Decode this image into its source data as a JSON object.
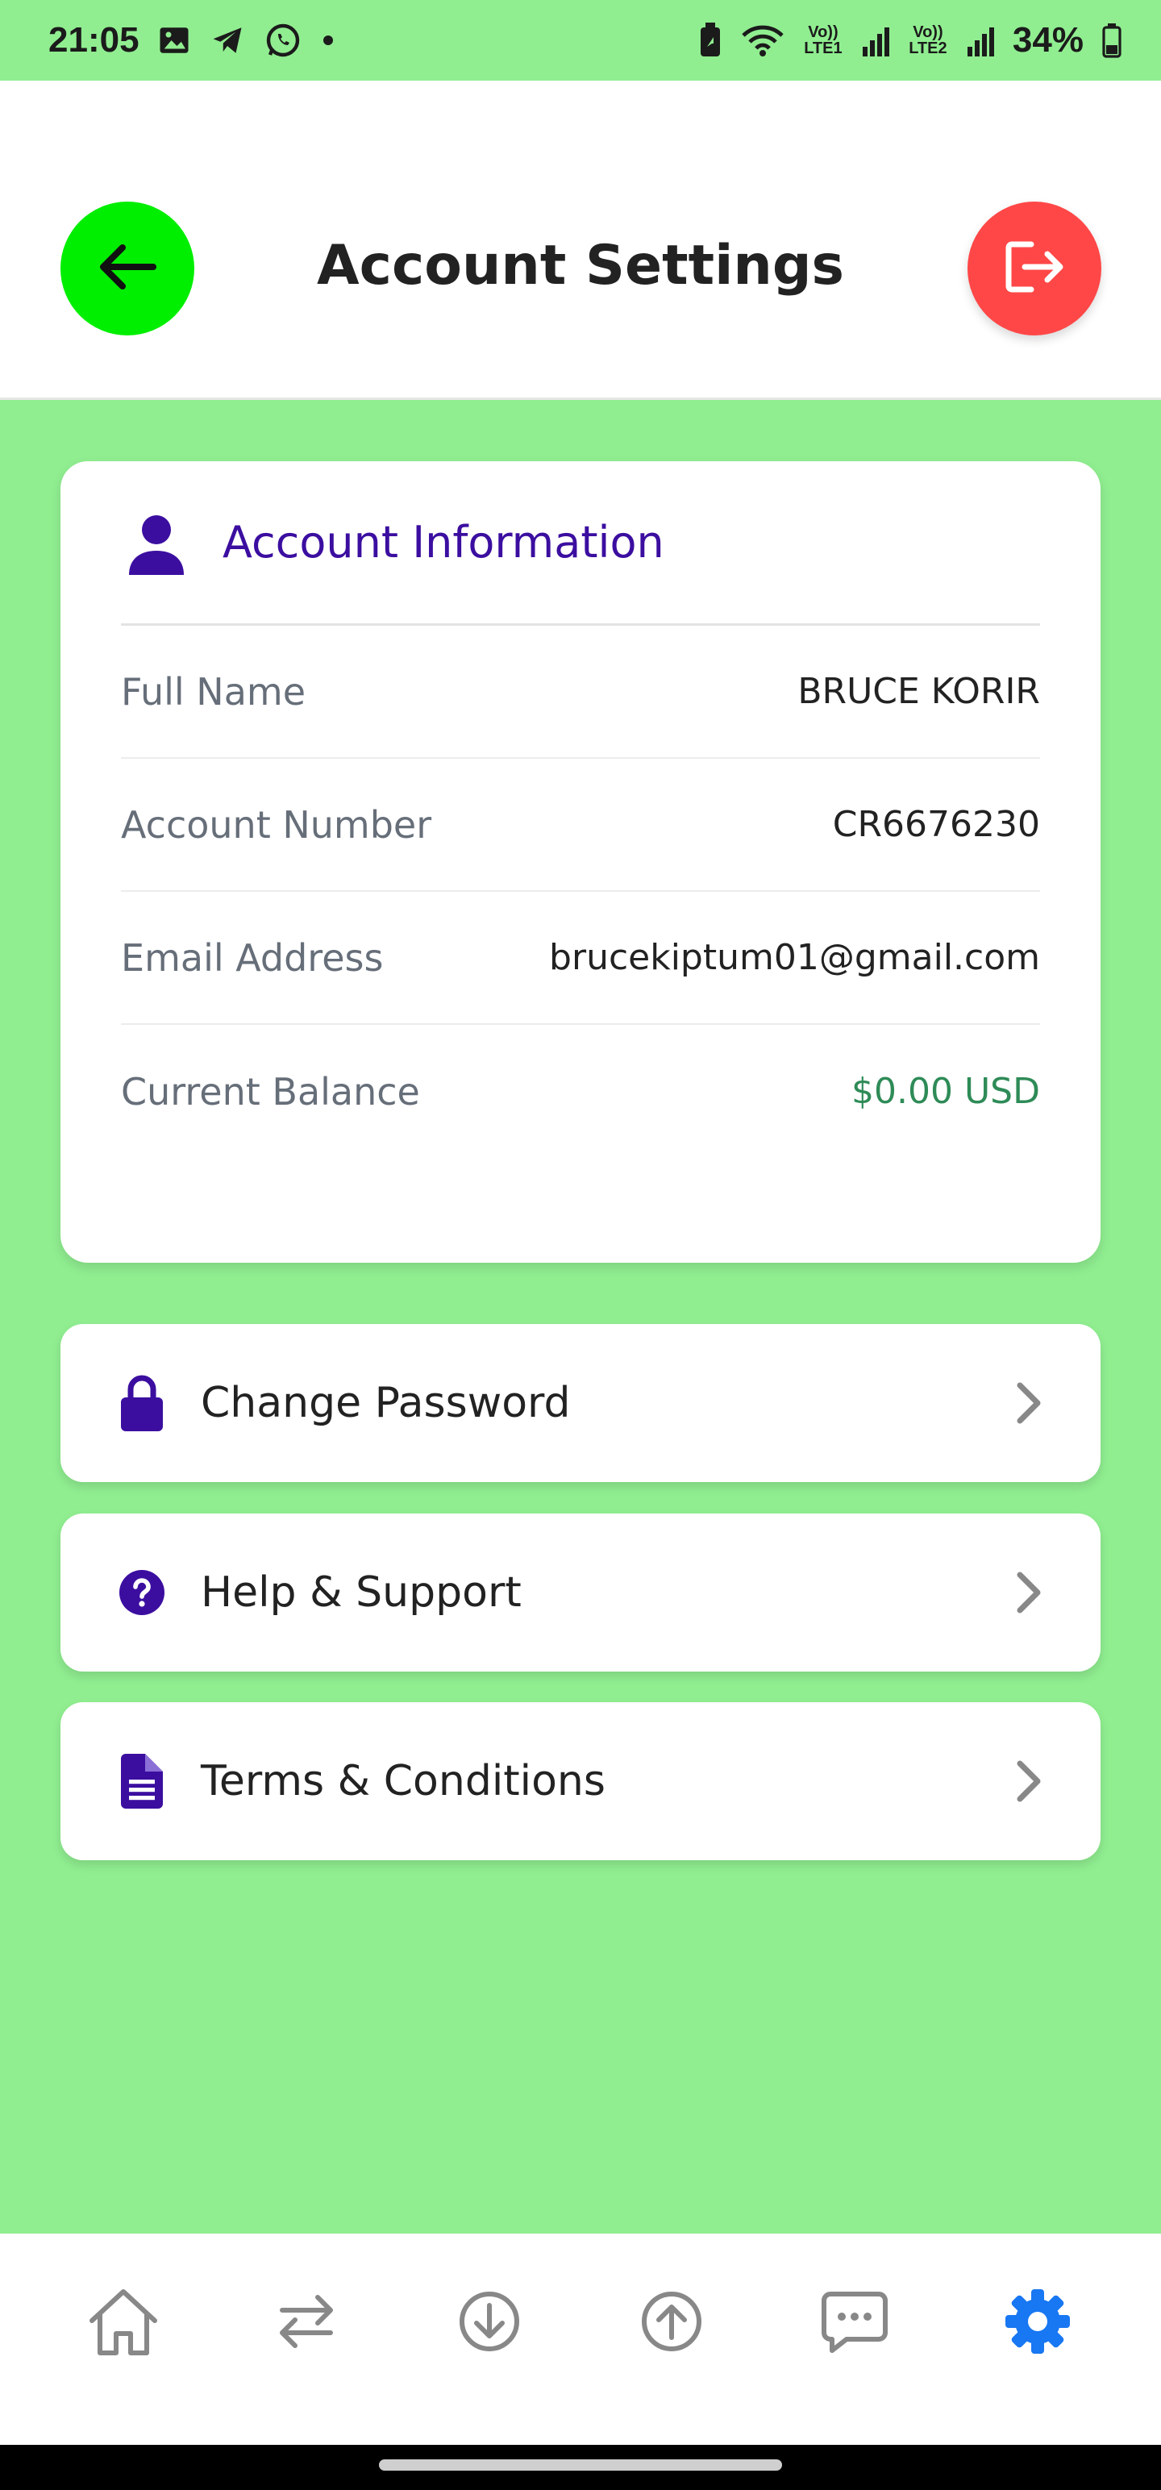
{
  "status_bar": {
    "time": "21:05",
    "battery": "34%",
    "sim1": "Vo)) LTE1",
    "sim2": "Vo)) LTE2"
  },
  "header": {
    "title": "Account Settings",
    "back_icon": "arrow-left-icon",
    "logout_icon": "logout-icon"
  },
  "account_info": {
    "title": "Account Information",
    "rows": [
      {
        "label": "Full Name",
        "value": "BRUCE KORIR"
      },
      {
        "label": "Account Number",
        "value": "CR6676230"
      },
      {
        "label": "Email Address",
        "value": "brucekiptum01@gmail.com"
      },
      {
        "label": "Current Balance",
        "value": "$0.00 USD"
      }
    ]
  },
  "menu": [
    {
      "label": "Change Password",
      "icon": "lock-icon"
    },
    {
      "label": "Help & Support",
      "icon": "help-icon"
    },
    {
      "label": "Terms & Conditions",
      "icon": "document-icon"
    }
  ],
  "bottom_nav": [
    {
      "icon": "home-icon",
      "active": false
    },
    {
      "icon": "transfer-icon",
      "active": false
    },
    {
      "icon": "download-icon",
      "active": false
    },
    {
      "icon": "upload-icon",
      "active": false
    },
    {
      "icon": "chat-icon",
      "active": false
    },
    {
      "icon": "settings-icon",
      "active": true
    }
  ],
  "colors": {
    "background": "#90EE90",
    "back_button": "#00EE00",
    "logout_button": "#FF4747",
    "accent_purple": "#3B0EA0",
    "balance_green": "#2E8B57",
    "active_nav": "#1877F2"
  }
}
